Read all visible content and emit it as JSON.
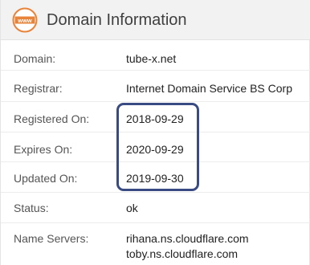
{
  "header": {
    "icon": "www-icon",
    "title": "Domain Information",
    "accent_color": "#e8833a"
  },
  "rows": [
    {
      "label": "Domain:",
      "value": "tube-x.net"
    },
    {
      "label": "Registrar:",
      "value": "Internet Domain Service BS Corp"
    },
    {
      "label": "Registered On:",
      "value": "2018-09-29"
    },
    {
      "label": "Expires On:",
      "value": "2020-09-29"
    },
    {
      "label": "Updated On:",
      "value": "2019-09-30"
    },
    {
      "label": "Status:",
      "value": "ok"
    },
    {
      "label": "Name Servers:",
      "values": [
        "rihana.ns.cloudflare.com",
        "toby.ns.cloudflare.com"
      ]
    }
  ],
  "highlight_color": "#3a4a82"
}
